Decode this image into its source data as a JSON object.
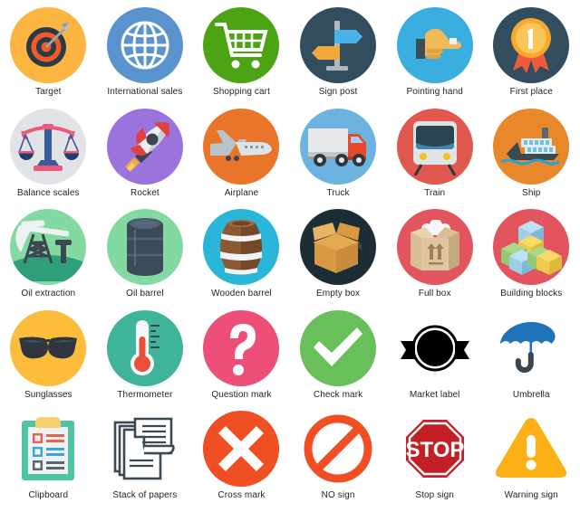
{
  "grid": {
    "columns": 6,
    "rows": 5,
    "background": "#ffffff",
    "caption_color": "#231f20"
  },
  "icons": [
    {
      "id": "target",
      "label": "Target",
      "icon_name": "target-icon",
      "disc_color": "#fbb540",
      "shape": "circle"
    },
    {
      "id": "international-sales",
      "label": "International sales",
      "icon_name": "globe-icon",
      "disc_color": "#5b93cf",
      "shape": "circle"
    },
    {
      "id": "shopping-cart",
      "label": "Shopping cart",
      "icon_name": "shopping-cart-icon",
      "disc_color": "#4ca313",
      "shape": "circle"
    },
    {
      "id": "sign-post",
      "label": "Sign post",
      "icon_name": "sign-post-icon",
      "disc_color": "#324d5e",
      "shape": "circle"
    },
    {
      "id": "pointing-hand",
      "label": "Pointing hand",
      "icon_name": "pointing-hand-icon",
      "disc_color": "#3aaede",
      "shape": "circle"
    },
    {
      "id": "first-place",
      "label": "First place",
      "icon_name": "award-ribbon-icon",
      "disc_color": "#324d5e",
      "shape": "circle"
    },
    {
      "id": "balance-scales",
      "label": "Balance scales",
      "icon_name": "balance-scales-icon",
      "disc_color": "#e2e3e6",
      "shape": "circle"
    },
    {
      "id": "rocket",
      "label": "Rocket",
      "icon_name": "rocket-icon",
      "disc_color": "#9b73dd",
      "shape": "circle"
    },
    {
      "id": "airplane",
      "label": "Airplane",
      "icon_name": "airplane-icon",
      "disc_color": "#e8752a",
      "shape": "circle"
    },
    {
      "id": "truck",
      "label": "Truck",
      "icon_name": "truck-icon",
      "disc_color": "#6cb3e0",
      "shape": "circle"
    },
    {
      "id": "train",
      "label": "Train",
      "icon_name": "train-icon",
      "disc_color": "#e0584f",
      "shape": "circle"
    },
    {
      "id": "ship",
      "label": "Ship",
      "icon_name": "ship-icon",
      "disc_color": "#e8882a",
      "shape": "circle"
    },
    {
      "id": "oil-extraction",
      "label": "Oil extraction",
      "icon_name": "oil-pumpjack-icon",
      "disc_color": "#84d9a2",
      "shape": "circle"
    },
    {
      "id": "oil-barrel",
      "label": "Oil barrel",
      "icon_name": "oil-barrel-icon",
      "disc_color": "#84d9a2",
      "shape": "circle"
    },
    {
      "id": "wooden-barrel",
      "label": "Wooden barrel",
      "icon_name": "wooden-barrel-icon",
      "disc_color": "#29b6d8",
      "shape": "circle"
    },
    {
      "id": "empty-box",
      "label": "Empty box",
      "icon_name": "open-box-icon",
      "disc_color": "#1d2d35",
      "shape": "circle"
    },
    {
      "id": "full-box",
      "label": "Full box",
      "icon_name": "full-box-icon",
      "disc_color": "#e2555f",
      "shape": "circle"
    },
    {
      "id": "building-blocks",
      "label": "Building blocks",
      "icon_name": "building-blocks-icon",
      "disc_color": "#e2555f",
      "shape": "circle"
    },
    {
      "id": "sunglasses",
      "label": "Sunglasses",
      "icon_name": "sunglasses-icon",
      "disc_color": "#fbbd3b",
      "shape": "circle"
    },
    {
      "id": "thermometer",
      "label": "Thermometer",
      "icon_name": "thermometer-icon",
      "disc_color": "#3fb49b",
      "shape": "circle"
    },
    {
      "id": "question-mark",
      "label": "Question mark",
      "icon_name": "question-mark-icon",
      "disc_color": "#ed4f79",
      "shape": "circle"
    },
    {
      "id": "check-mark",
      "label": "Check mark",
      "icon_name": "check-mark-icon",
      "disc_color": "#69c05b",
      "shape": "circle"
    },
    {
      "id": "market-label",
      "label": "Market label",
      "icon_name": "market-label-icon",
      "disc_color": "#000000",
      "shape": "badge"
    },
    {
      "id": "umbrella",
      "label": "Umbrella",
      "icon_name": "umbrella-icon",
      "disc_color": "#1f73b8",
      "shape": "plain"
    },
    {
      "id": "clipboard",
      "label": "Clipboard",
      "icon_name": "clipboard-icon",
      "disc_color": "#4ec4a4",
      "shape": "square"
    },
    {
      "id": "stack-of-papers",
      "label": "Stack of papers",
      "icon_name": "stack-of-papers-icon",
      "disc_color": "#3b4a52",
      "shape": "plain"
    },
    {
      "id": "cross-mark",
      "label": "Cross mark",
      "icon_name": "cross-mark-icon",
      "disc_color": "#f04e23",
      "shape": "circle"
    },
    {
      "id": "no-sign",
      "label": "NO sign",
      "icon_name": "no-sign-icon",
      "disc_color": "#f04e23",
      "shape": "plain"
    },
    {
      "id": "stop-sign",
      "label": "Stop sign",
      "icon_name": "stop-sign-icon",
      "disc_color": "#c22026",
      "shape": "plain",
      "text": "STOP"
    },
    {
      "id": "warning-sign",
      "label": "Warning sign",
      "icon_name": "warning-sign-icon",
      "disc_color": "#fbb116",
      "shape": "plain"
    }
  ]
}
